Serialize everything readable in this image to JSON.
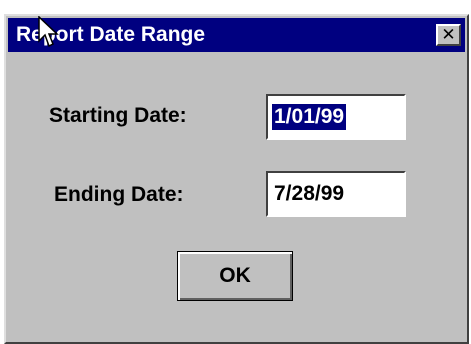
{
  "window": {
    "title": "Report Date Range",
    "close_glyph": "✕"
  },
  "form": {
    "start_label": "Starting Date:",
    "start_value": "1/01/99",
    "end_label": "Ending Date:",
    "end_value": "7/28/99"
  },
  "buttons": {
    "ok_label": "OK"
  },
  "colors": {
    "titlebar": "#000080",
    "dialog_face": "#c0c0c0",
    "selection": "#000080"
  },
  "icons": {
    "cursor": "mouse-pointer-icon",
    "close": "close-icon"
  }
}
